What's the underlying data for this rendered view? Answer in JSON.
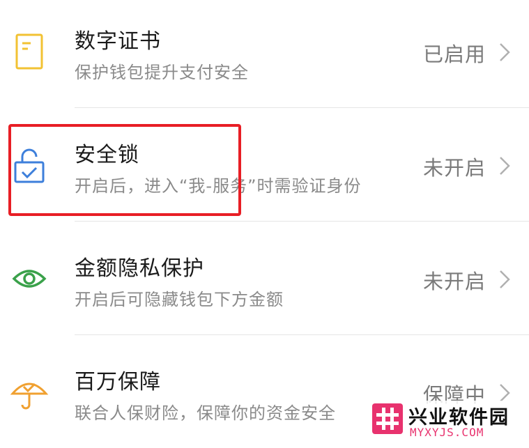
{
  "settings_list": {
    "items": [
      {
        "title": "数字证书",
        "subtitle": "保护钱包提升支付安全",
        "status": "已启用",
        "icon": "certificate-icon",
        "icon_color": "#f2c233"
      },
      {
        "title": "安全锁",
        "subtitle": "开启后，进入“我-服务”时需验证身份",
        "status": "未开启",
        "icon": "lock-icon",
        "icon_color": "#3d7fdb"
      },
      {
        "title": "金额隐私保护",
        "subtitle": "开启后可隐藏钱包下方金额",
        "status": "未开启",
        "icon": "eye-icon",
        "icon_color": "#3aa14a"
      },
      {
        "title": "百万保障",
        "subtitle": "联合人保财险，保障你的资金安全",
        "status": "保障中",
        "icon": "umbrella-icon",
        "icon_color": "#f0a030"
      }
    ]
  },
  "annotation": {
    "highlight_color": "#e81e25"
  },
  "watermark": {
    "name": "兴业软件园",
    "url": "MYXYJS.COM",
    "color": "#e8326e"
  }
}
